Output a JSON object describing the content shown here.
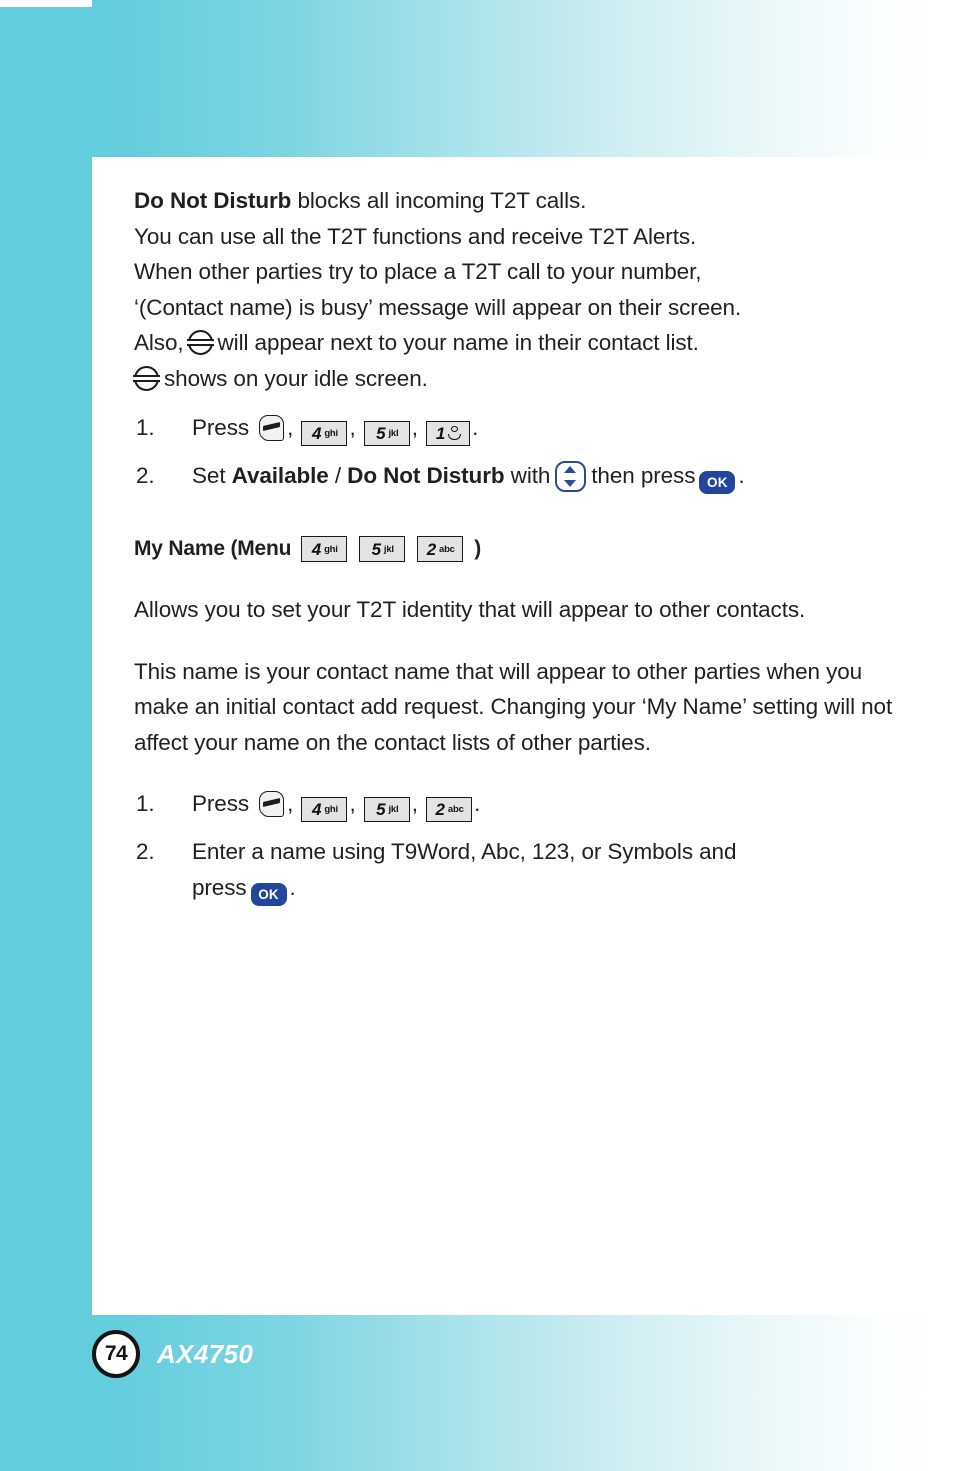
{
  "document": {
    "page_number": "74",
    "model_name": "AX4750",
    "background_accent_color": "#62cddd",
    "panel_color": "#ffffff",
    "key_accent_color": "#23459c"
  },
  "dnd_section": {
    "intro_lines": [
      {
        "bold": "Do Not Disturb",
        "rest": " blocks all incoming T2T calls."
      },
      {
        "bold": "",
        "rest": "You can use all the T2T functions and receive T2T Alerts."
      },
      {
        "bold": "",
        "rest": "When other parties try to place a T2T call to your number,"
      },
      {
        "bold": "",
        "rest": "‘(Contact name) is busy’ message will appear on their screen."
      }
    ],
    "also_prefix": "Also,",
    "also_suffix": "will appear next to your name in their contact list.",
    "idle_suffix": "shows on your idle screen.",
    "steps": [
      {
        "number": "1.",
        "text_before": "Press",
        "keys": [
          {
            "type": "send",
            "name": "send-key-icon"
          },
          {
            "type": "keycap",
            "digit": "4",
            "letters": "ghi"
          },
          {
            "type": "keycap",
            "digit": "5",
            "letters": "jkl"
          },
          {
            "type": "keycap-one",
            "digit": "1",
            "letters": ""
          }
        ],
        "text_after": "."
      },
      {
        "number": "2.",
        "segments": {
          "set": "Set ",
          "available": "Available",
          "slash": " / ",
          "dnd": "Do Not Disturb",
          "with": " with",
          "then_press": "then press",
          "period": "."
        },
        "nav_key_label": "nav-up-down-key",
        "ok_key_label": "OK"
      }
    ]
  },
  "myname_section": {
    "heading": {
      "label_before": "My Name (Menu",
      "keys": [
        {
          "digit": "4",
          "letters": "ghi"
        },
        {
          "digit": "5",
          "letters": "jkl"
        },
        {
          "digit": "2",
          "letters": "abc"
        }
      ],
      "label_after": ")"
    },
    "paragraphs": [
      "Allows you to set your T2T identity that will appear to other contacts.",
      "This name is your contact name that will appear to other parties when you make an initial contact add request. Changing your ‘My Name’ setting will not affect your name on the contact lists of other parties."
    ],
    "steps": [
      {
        "number": "1.",
        "text_before": "Press",
        "keys": [
          {
            "type": "send"
          },
          {
            "type": "keycap",
            "digit": "4",
            "letters": "ghi"
          },
          {
            "type": "keycap",
            "digit": "5",
            "letters": "jkl"
          },
          {
            "type": "keycap",
            "digit": "2",
            "letters": "abc"
          }
        ],
        "text_after": "."
      },
      {
        "number": "2.",
        "line1": "Enter a name using T9Word, Abc, 123, or Symbols and",
        "line2_before": "press",
        "ok_key_label": "OK",
        "line2_after": "."
      }
    ]
  }
}
